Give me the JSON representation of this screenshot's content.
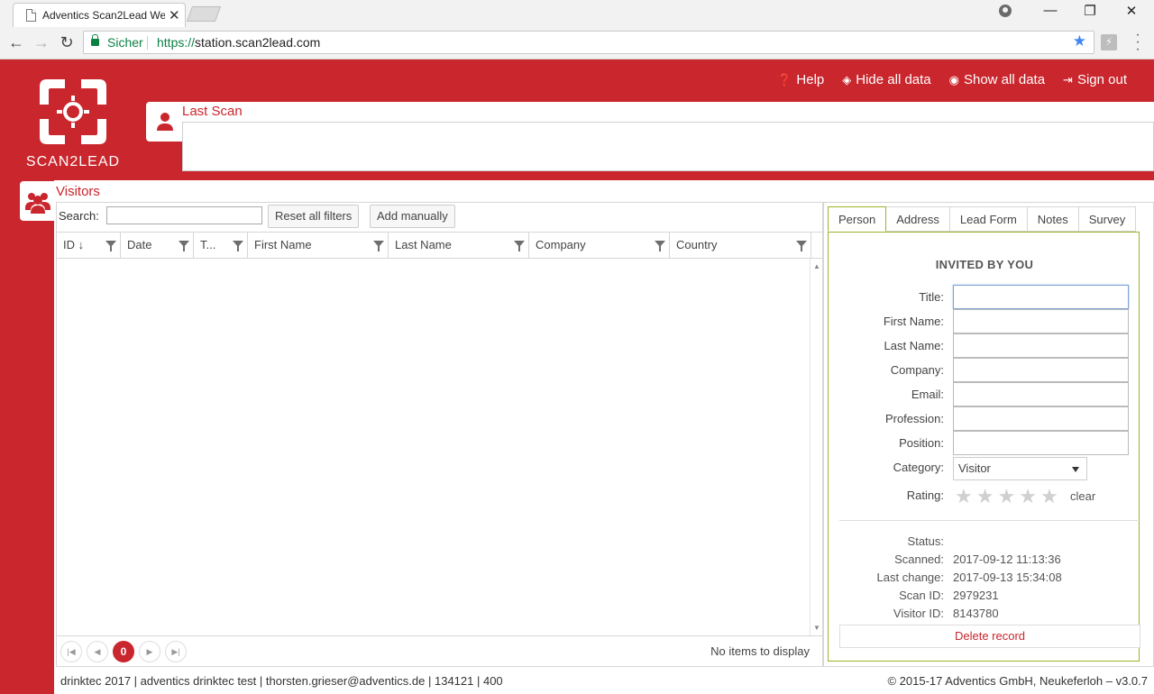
{
  "browser": {
    "tab_title": "Adventics Scan2Lead We",
    "secure_label": "Sicher",
    "url_protocol": "https://",
    "url_host": "station.scan2lead.com"
  },
  "header": {
    "logo_text": "SCAN2LEAD",
    "nav": [
      {
        "label": "Help",
        "icon": "help-icon"
      },
      {
        "label": "Hide all data",
        "icon": "eye-slash-icon"
      },
      {
        "label": "Show all data",
        "icon": "eye-icon"
      },
      {
        "label": "Sign out",
        "icon": "sign-out-icon"
      }
    ],
    "last_scan_title": "Last Scan"
  },
  "visitors": {
    "title": "Visitors",
    "search_label": "Search:",
    "search_value": "",
    "reset_filters_label": "Reset all filters",
    "add_manually_label": "Add manually",
    "columns": [
      "ID ↓",
      "Date",
      "T...",
      "First Name",
      "Last Name",
      "Company",
      "Country"
    ],
    "rows": [],
    "pager_current": "0",
    "no_items_text": "No items to display"
  },
  "detail": {
    "tabs": [
      "Person",
      "Address",
      "Lead Form",
      "Notes",
      "Survey"
    ],
    "active_tab": "Person",
    "heading": "INVITED BY YOU",
    "fields": [
      {
        "label": "Title:",
        "value": ""
      },
      {
        "label": "First Name:",
        "value": ""
      },
      {
        "label": "Last Name:",
        "value": ""
      },
      {
        "label": "Company:",
        "value": ""
      },
      {
        "label": "Email:",
        "value": ""
      },
      {
        "label": "Profession:",
        "value": ""
      },
      {
        "label": "Position:",
        "value": ""
      }
    ],
    "category_label": "Category:",
    "category_value": "Visitor",
    "rating_label": "Rating:",
    "rating_value": 0,
    "rating_max": 5,
    "rating_clear": "clear",
    "meta": [
      {
        "label": "Status:",
        "value": ""
      },
      {
        "label": "Scanned:",
        "value": "2017-09-12 11:13:36"
      },
      {
        "label": "Last change:",
        "value": "2017-09-13 15:34:08"
      },
      {
        "label": "Scan ID:",
        "value": "2979231"
      },
      {
        "label": "Visitor ID:",
        "value": "8143780"
      }
    ],
    "delete_label": "Delete record"
  },
  "footer": {
    "left": "drinktec 2017 | adventics drinktec test | thorsten.grieser@adventics.de | 134121 | 400",
    "right": "© 2015-17 Adventics GmbH, Neukeferloh – v3.0.7"
  },
  "colors": {
    "brand_red": "#c9262d",
    "tab_border_green": "#9cb227"
  }
}
